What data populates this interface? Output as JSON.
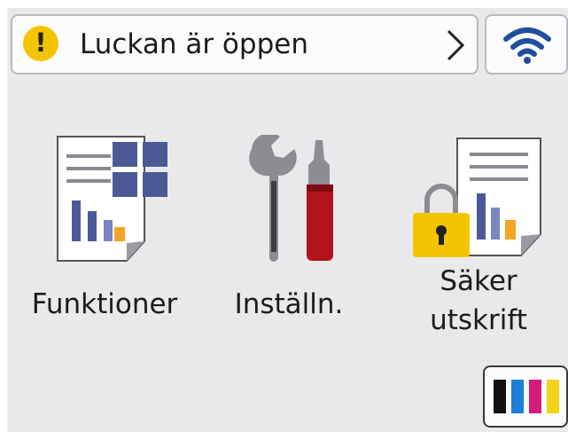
{
  "status": {
    "warning_glyph": "!",
    "message": "Luckan är öppen",
    "icon": "warning-icon",
    "chevron_icon": "chevron-right-icon"
  },
  "wifi": {
    "icon": "wifi-icon"
  },
  "apps": [
    {
      "label": "Funktioner",
      "icon": "functions-icon"
    },
    {
      "label": "Inställn.",
      "icon": "settings-tools-icon"
    },
    {
      "label_line1": "Säker",
      "label_line2": "utskrift",
      "icon": "secure-print-icon"
    }
  ],
  "ink": {
    "icon": "ink-cartridges-icon",
    "colors": [
      "#111111",
      "#1a7fd8",
      "#d6197d",
      "#f4d21a"
    ]
  },
  "colors": {
    "warning": "#f5c400",
    "wifi": "#1f4e9c",
    "tile": "#4b5a97",
    "accent_orange": "#f2a623",
    "screwdriver": "#b3131c",
    "lock": "#f5c400"
  }
}
